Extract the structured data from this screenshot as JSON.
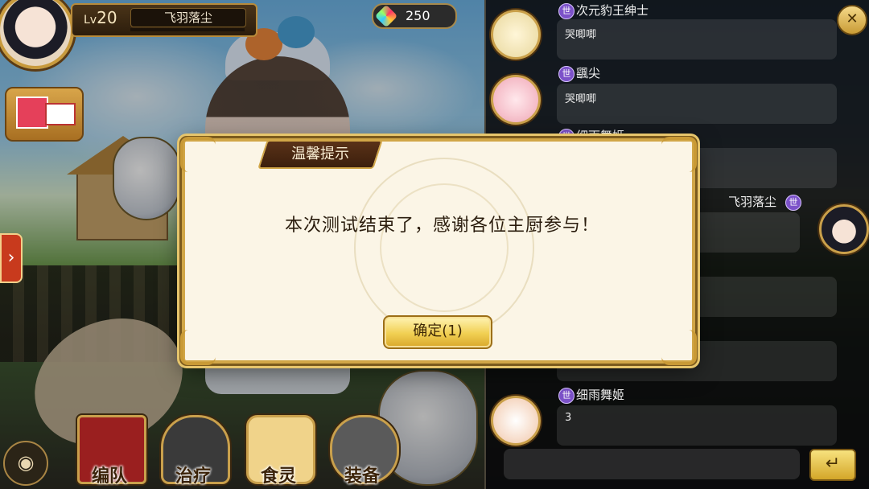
{
  "hud": {
    "level_prefix": "Lv",
    "level": "20",
    "player_name": "飞羽落尘",
    "gems": "250"
  },
  "menu": {
    "items": [
      {
        "label": "编队"
      },
      {
        "label": "治疗"
      },
      {
        "label": "食灵"
      },
      {
        "label": "装备"
      }
    ]
  },
  "chat": {
    "messages": [
      {
        "name": "次元豹王绅士",
        "text": "哭唧唧"
      },
      {
        "name": "颻尖",
        "text": "哭唧唧"
      },
      {
        "name": "细雨舞姬",
        "text": ""
      },
      {
        "name": "飞羽落尘",
        "text": ""
      },
      {
        "name": "",
        "text": ""
      },
      {
        "name": "",
        "text": ""
      },
      {
        "name": "细雨舞姬",
        "text": "3"
      }
    ],
    "world_tag": "世",
    "send_icon": "↵"
  },
  "dialog": {
    "title": "温馨提示",
    "message": "本次测试结束了，感谢各位主厨参与！",
    "ok_label": "确定(1)"
  },
  "colors": {
    "gold": "#d1a647",
    "dialog_bg": "#fbf5e6",
    "world_tag": "#7c52c9"
  },
  "icons": {
    "gem": "gem-icon",
    "gift": "gift-mail-icon",
    "eye": "eye-icon",
    "send": "enter-icon"
  }
}
